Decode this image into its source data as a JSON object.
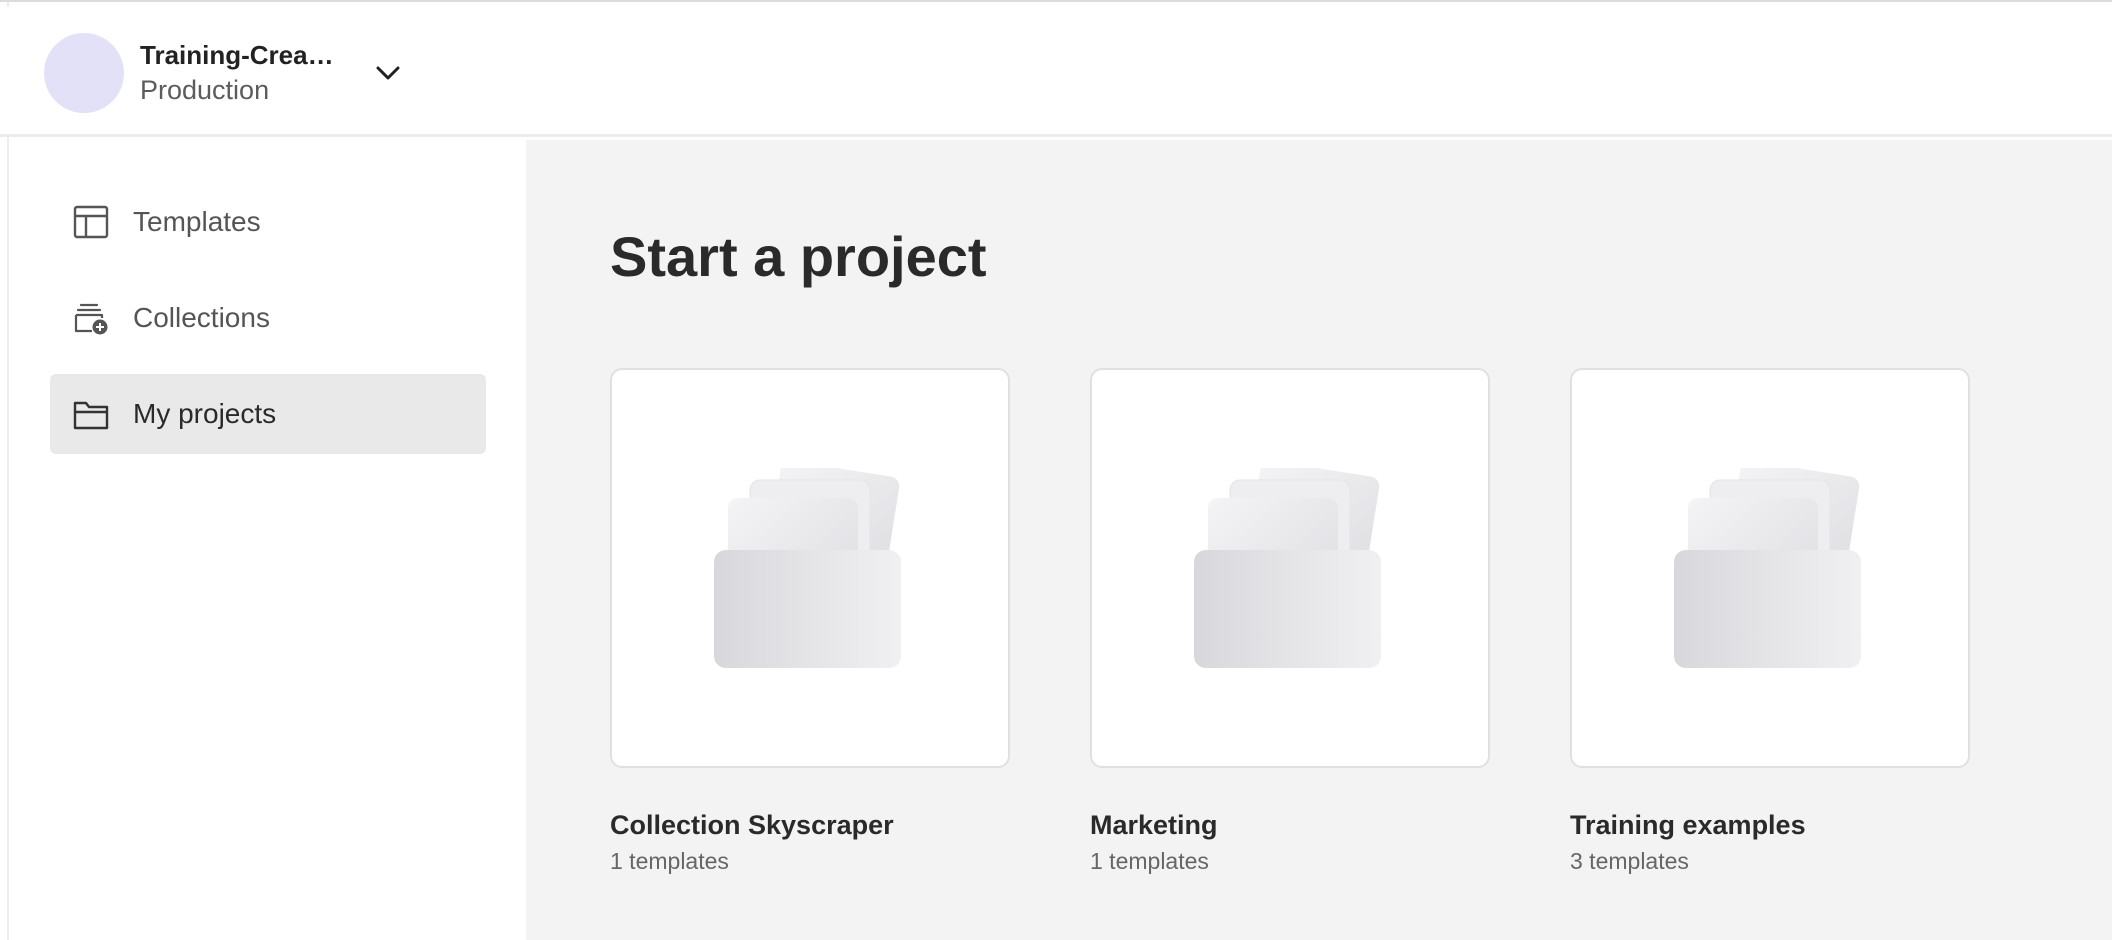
{
  "workspace": {
    "name": "Training-Crea…",
    "environment": "Production",
    "avatar_color": "#e2e1f7"
  },
  "sidebar": {
    "items": [
      {
        "label": "Templates",
        "icon": "template-layout-icon",
        "active": false
      },
      {
        "label": "Collections",
        "icon": "collections-add-icon",
        "active": false
      },
      {
        "label": "My projects",
        "icon": "folder-icon",
        "active": true
      }
    ]
  },
  "main": {
    "title": "Start a project",
    "cards": [
      {
        "title": "Collection Skyscraper",
        "count": "1 templates",
        "icon": "folder-illustration-icon"
      },
      {
        "title": "Marketing",
        "count": "1 templates",
        "icon": "folder-illustration-icon"
      },
      {
        "title": "Training examples",
        "count": "3 templates",
        "icon": "folder-illustration-icon"
      }
    ]
  },
  "colors": {
    "main_background": "#f3f3f3",
    "active_nav_background": "#e9e9e9",
    "text_primary": "#2a2a2a",
    "text_secondary": "#5c5c5c"
  }
}
